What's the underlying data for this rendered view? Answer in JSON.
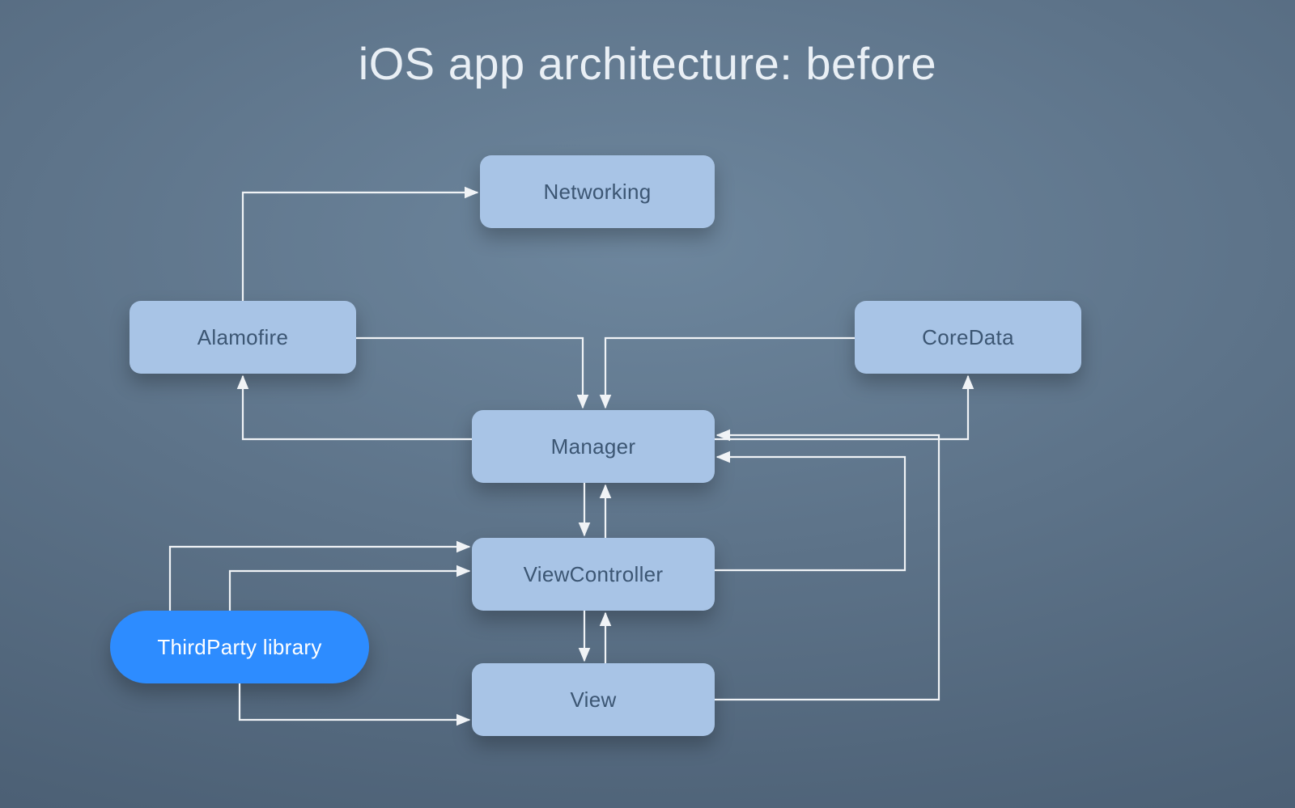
{
  "title": "iOS app architecture: before",
  "nodes": {
    "networking": {
      "label": "Networking"
    },
    "alamofire": {
      "label": "Alamofire"
    },
    "coredata": {
      "label": "CoreData"
    },
    "manager": {
      "label": "Manager"
    },
    "viewcontroller": {
      "label": "ViewController"
    },
    "view": {
      "label": "View"
    },
    "thirdparty": {
      "label": "ThirdParty library"
    }
  },
  "colors": {
    "nodeFill": "#a8c4e6",
    "nodeText": "#3c5673",
    "accentFill": "#2d8cff",
    "connector": "#f0f3f6"
  },
  "edges": [
    {
      "from": "alamofire",
      "to": "networking"
    },
    {
      "from": "alamofire",
      "to": "manager"
    },
    {
      "from": "coredata",
      "to": "manager"
    },
    {
      "from": "manager",
      "to": "alamofire"
    },
    {
      "from": "manager",
      "to": "coredata"
    },
    {
      "from": "manager",
      "to": "viewcontroller",
      "bidirectional": true
    },
    {
      "from": "viewcontroller",
      "to": "view",
      "bidirectional": true
    },
    {
      "from": "viewcontroller",
      "to": "manager",
      "via": "right-loop-short"
    },
    {
      "from": "view",
      "to": "manager",
      "via": "right-loop-long"
    },
    {
      "from": "thirdparty",
      "to": "viewcontroller"
    },
    {
      "from": "thirdparty",
      "to": "view"
    }
  ]
}
